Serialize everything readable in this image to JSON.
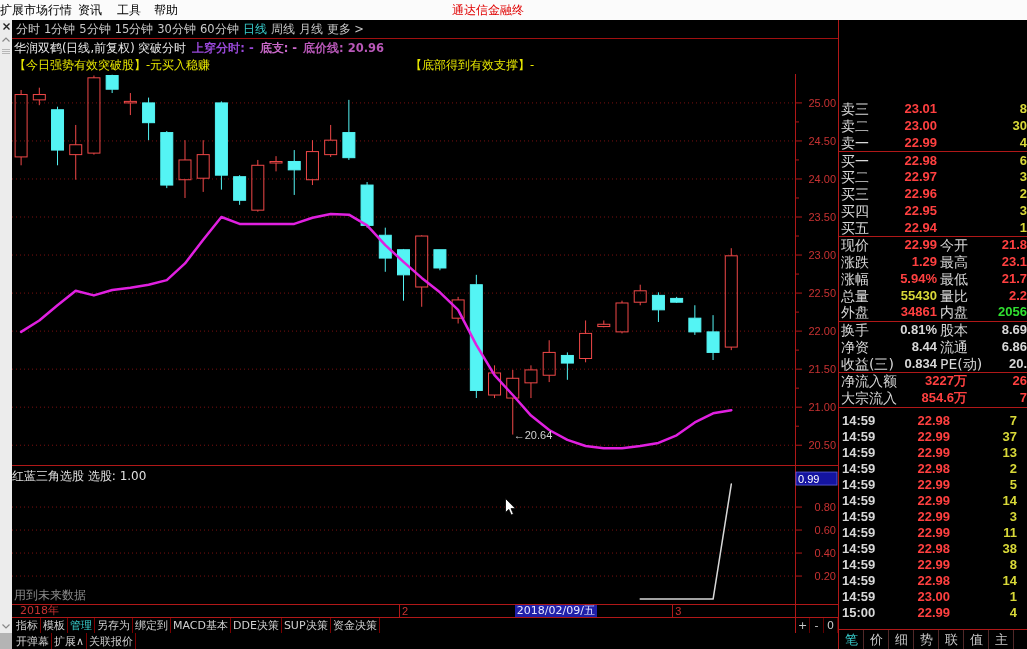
{
  "menu_bar": {
    "items": [
      "扩展市场行情",
      "资讯",
      "工具",
      "帮助"
    ],
    "brand": "通达信金融终"
  },
  "period_tabs": [
    {
      "label": "分时",
      "selected": false
    },
    {
      "label": "1分钟",
      "selected": false
    },
    {
      "label": "5分钟",
      "selected": false
    },
    {
      "label": "15分钟",
      "selected": false
    },
    {
      "label": "30分钟",
      "selected": false
    },
    {
      "label": "60分钟",
      "selected": false
    },
    {
      "label": "日线",
      "selected": true
    },
    {
      "label": "周线",
      "selected": false
    },
    {
      "label": "月线",
      "selected": false
    },
    {
      "label": "更多 >",
      "selected": false
    }
  ],
  "header": {
    "title": "华润双鹤(日线,前复权) 突破分时",
    "indicators": [
      {
        "text": "上穿分时: -",
        "color": "#9848d8"
      },
      {
        "text": "底支: -",
        "color": "#c868c8"
      },
      {
        "text": "底价线: 20.96",
        "color": "#b858b8"
      }
    ]
  },
  "signals": [
    "【今日强势有效突破股】-元买入稳赚",
    "【底部得到有效支撑】-"
  ],
  "price_chart": {
    "chart_data": {
      "type": "candlestick",
      "grid": true,
      "categories": [
        null,
        null,
        null,
        null,
        null,
        null,
        null,
        null,
        null,
        null,
        null,
        null,
        null,
        null,
        null,
        null,
        null,
        null,
        null,
        null,
        null,
        null,
        null,
        null,
        null,
        null,
        null,
        null,
        null,
        null,
        null,
        null,
        null,
        null,
        null,
        null,
        null,
        null,
        null,
        null,
        null,
        null,
        null
      ],
      "ylim": [
        20.24,
        25.38
      ],
      "yticks": [
        {
          "value": 20.5,
          "label": "20.50"
        },
        {
          "value": 21,
          "label": "21.00"
        },
        {
          "value": 21.5,
          "label": "21.50"
        },
        {
          "value": 22,
          "label": "22.00"
        },
        {
          "value": 22.5,
          "label": "22.50"
        },
        {
          "value": 23,
          "label": "23.00"
        },
        {
          "value": 23.5,
          "label": "23.50"
        },
        {
          "value": 24,
          "label": "24.00"
        },
        {
          "value": 24.5,
          "label": "24.50"
        },
        {
          "value": 25,
          "label": "25.00"
        }
      ],
      "ohlc": [
        [
          24.29,
          25.17,
          24.18,
          25.11
        ],
        [
          25.04,
          25.2,
          24.97,
          25.11
        ],
        [
          24.91,
          24.95,
          24.18,
          24.38
        ],
        [
          24.32,
          24.71,
          23.99,
          24.45
        ],
        [
          24.34,
          25.36,
          24.32,
          25.33
        ],
        [
          25.36,
          25.37,
          25.13,
          25.18
        ],
        [
          25.0,
          25.13,
          24.84,
          25.02
        ],
        [
          25.0,
          25.07,
          24.51,
          24.74
        ],
        [
          24.61,
          24.63,
          23.88,
          23.92
        ],
        [
          23.99,
          24.51,
          23.75,
          24.25
        ],
        [
          24.01,
          24.51,
          23.83,
          24.32
        ],
        [
          25.0,
          25.02,
          23.86,
          24.05
        ],
        [
          24.03,
          24.05,
          23.66,
          23.72
        ],
        [
          23.59,
          24.25,
          23.57,
          24.18
        ],
        [
          24.21,
          24.3,
          24.1,
          24.23
        ],
        [
          24.23,
          24.38,
          23.79,
          24.12
        ],
        [
          23.99,
          24.51,
          23.92,
          24.36
        ],
        [
          24.32,
          24.71,
          24.29,
          24.51
        ],
        [
          24.61,
          25.04,
          24.25,
          24.28
        ],
        [
          23.92,
          23.96,
          23.36,
          23.39
        ],
        [
          23.26,
          23.36,
          22.78,
          22.96
        ],
        [
          23.07,
          23.08,
          22.4,
          22.74
        ],
        [
          22.58,
          23.26,
          22.32,
          23.25
        ],
        [
          23.07,
          23.07,
          22.8,
          22.83
        ],
        [
          22.17,
          22.45,
          22.1,
          22.41
        ],
        [
          22.61,
          22.74,
          21.12,
          21.22
        ],
        [
          21.16,
          21.55,
          21.12,
          21.45
        ],
        [
          21.12,
          21.49,
          20.64,
          21.38
        ],
        [
          21.32,
          21.55,
          21.12,
          21.49
        ],
        [
          21.42,
          21.88,
          21.33,
          21.72
        ],
        [
          21.68,
          21.72,
          21.36,
          21.58
        ],
        [
          21.64,
          22.14,
          21.59,
          21.97
        ],
        [
          22.06,
          22.14,
          22.05,
          22.09
        ],
        [
          21.99,
          22.4,
          21.97,
          22.37
        ],
        [
          22.38,
          22.61,
          22.34,
          22.53
        ],
        [
          22.47,
          22.51,
          22.12,
          22.28
        ],
        [
          22.43,
          22.45,
          22.37,
          22.38
        ],
        [
          22.17,
          22.34,
          21.95,
          21.99
        ],
        [
          21.99,
          22.21,
          21.62,
          21.72
        ],
        [
          21.79,
          23.09,
          21.75,
          22.99
        ],
        null,
        null,
        null
      ],
      "series": [
        {
          "type": "line",
          "color": "#e020e0",
          "values": [
            21.99,
            22.14,
            22.34,
            22.53,
            22.47,
            22.54,
            22.57,
            22.61,
            22.67,
            22.89,
            23.2,
            23.5,
            23.41,
            23.41,
            23.41,
            23.41,
            23.49,
            23.54,
            23.53,
            23.39,
            23.13,
            22.91,
            22.7,
            22.51,
            22.28,
            21.82,
            21.42,
            21.16,
            20.89,
            20.7,
            20.57,
            20.49,
            20.46,
            20.46,
            20.49,
            20.53,
            20.63,
            20.8,
            20.92,
            20.96,
            null,
            null,
            null
          ]
        }
      ],
      "annotations": [
        "←20.64"
      ]
    }
  },
  "indicator_chart": {
    "note": "用到未来数据",
    "chart_data": {
      "type": "line",
      "title": "红蓝三角选股 选股: 1.00",
      "grid": true,
      "xlabel": "2018年",
      "categories": [
        null,
        null,
        null,
        null,
        null,
        null,
        null,
        null,
        null,
        null,
        null,
        null,
        null,
        null,
        null,
        null,
        null,
        null,
        null,
        null,
        null,
        "2",
        null,
        null,
        null,
        null,
        null,
        null,
        null,
        null,
        null,
        null,
        null,
        null,
        null,
        null,
        "3",
        null,
        null,
        null,
        null,
        null,
        null
      ],
      "ylim": [
        -0.043,
        1.157
      ],
      "yticks": [
        {
          "value": 0.2,
          "label": "0.20"
        },
        {
          "value": 0.4,
          "label": "0.40"
        },
        {
          "value": 0.6,
          "label": "0.60"
        },
        {
          "value": 0.8,
          "label": "0.80"
        }
      ],
      "series": [
        {
          "color": "#d8d8d8",
          "values": [
            null,
            null,
            null,
            null,
            null,
            null,
            null,
            null,
            null,
            null,
            null,
            null,
            null,
            null,
            null,
            null,
            null,
            null,
            null,
            null,
            null,
            null,
            null,
            null,
            null,
            null,
            null,
            null,
            null,
            null,
            null,
            null,
            null,
            null,
            0,
            0,
            0,
            0,
            0,
            1,
            null,
            null,
            null
          ]
        }
      ],
      "annotations": [
        "2018/02/09/五",
        "0.99"
      ]
    }
  },
  "toolbar": {
    "tabs": [
      {
        "label": "指标",
        "selected": false
      },
      {
        "label": "模板",
        "selected": false
      },
      {
        "label": "管理",
        "selected": true
      },
      {
        "label": "另存为",
        "selected": false
      },
      {
        "label": "绑定到",
        "selected": false
      },
      {
        "label": "MACD基本",
        "selected": false
      },
      {
        "label": "DDE决策",
        "selected": false
      },
      {
        "label": "SUP决策",
        "selected": false
      },
      {
        "label": "资金决策",
        "selected": false
      }
    ],
    "zoom_buttons": [
      "+",
      "-",
      "0"
    ],
    "links": [
      "开弹幕",
      "扩展∧",
      "关联报价"
    ]
  },
  "quote_panel": {
    "asks": [
      {
        "label": "卖三",
        "price": "23.01",
        "volume": "8"
      },
      {
        "label": "卖二",
        "price": "23.00",
        "volume": "30"
      },
      {
        "label": "卖一",
        "price": "22.99",
        "volume": "4"
      }
    ],
    "bids": [
      {
        "label": "买一",
        "price": "22.98",
        "volume": "6"
      },
      {
        "label": "买二",
        "price": "22.97",
        "volume": "3"
      },
      {
        "label": "买三",
        "price": "22.96",
        "volume": "2"
      },
      {
        "label": "买四",
        "price": "22.95",
        "volume": "3"
      },
      {
        "label": "买五",
        "price": "22.94",
        "volume": "1"
      }
    ],
    "stats": [
      {
        "cells": [
          {
            "label": "现价",
            "value": "22.99",
            "color": "#ff4040"
          },
          {
            "label": "今开",
            "value": "21.8",
            "color": "#ff4040"
          }
        ]
      },
      {
        "cells": [
          {
            "label": "涨跌",
            "value": "1.29",
            "color": "#ff4040"
          },
          {
            "label": "最高",
            "value": "23.1",
            "color": "#ff4040"
          }
        ]
      },
      {
        "cells": [
          {
            "label": "涨幅",
            "value": "5.94%",
            "color": "#ff4040"
          },
          {
            "label": "最低",
            "value": "21.7",
            "color": "#ff4040"
          }
        ]
      },
      {
        "cells": [
          {
            "label": "总量",
            "value": "55430",
            "color": "#d8d838"
          },
          {
            "label": "量比",
            "value": "2.2",
            "color": "#ff4040"
          }
        ]
      },
      {
        "cells": [
          {
            "label": "外盘",
            "value": "34861",
            "color": "#ff4040"
          },
          {
            "label": "内盘",
            "value": "2056",
            "color": "#30e030"
          }
        ]
      }
    ],
    "finance": [
      {
        "cells": [
          {
            "label": "换手",
            "value": "0.81%"
          },
          {
            "label": "股本",
            "value": "8.69"
          }
        ]
      },
      {
        "cells": [
          {
            "label": "净资",
            "value": "8.44"
          },
          {
            "label": "流通",
            "value": "6.86"
          }
        ]
      },
      {
        "cells": [
          {
            "label": "收益(三)",
            "value": "0.834"
          },
          {
            "label": "PE(动)",
            "value": "20."
          }
        ]
      }
    ],
    "fund_flow": [
      {
        "label": "净流入额",
        "value": "3227万",
        "value2": "26"
      },
      {
        "label": "大宗流入",
        "value": "854.6万",
        "value2": "7"
      }
    ],
    "trades": [
      {
        "time": "14:59",
        "price": "22.98",
        "volume": "7"
      },
      {
        "time": "14:59",
        "price": "22.99",
        "volume": "37"
      },
      {
        "time": "14:59",
        "price": "22.99",
        "volume": "13"
      },
      {
        "time": "14:59",
        "price": "22.98",
        "volume": "2"
      },
      {
        "time": "14:59",
        "price": "22.99",
        "volume": "5"
      },
      {
        "time": "14:59",
        "price": "22.99",
        "volume": "14"
      },
      {
        "time": "14:59",
        "price": "22.99",
        "volume": "3"
      },
      {
        "time": "14:59",
        "price": "22.99",
        "volume": "11"
      },
      {
        "time": "14:59",
        "price": "22.98",
        "volume": "38"
      },
      {
        "time": "14:59",
        "price": "22.99",
        "volume": "8"
      },
      {
        "time": "14:59",
        "price": "22.98",
        "volume": "14"
      },
      {
        "time": "14:59",
        "price": "23.00",
        "volume": "1"
      },
      {
        "time": "15:00",
        "price": "22.99",
        "volume": "4"
      }
    ],
    "tabs": [
      {
        "label": "笔",
        "selected": true
      },
      {
        "label": "价",
        "selected": false
      },
      {
        "label": "细",
        "selected": false
      },
      {
        "label": "势",
        "selected": false
      },
      {
        "label": "联",
        "selected": false
      },
      {
        "label": "值",
        "selected": false
      },
      {
        "label": "主",
        "selected": false
      }
    ]
  }
}
